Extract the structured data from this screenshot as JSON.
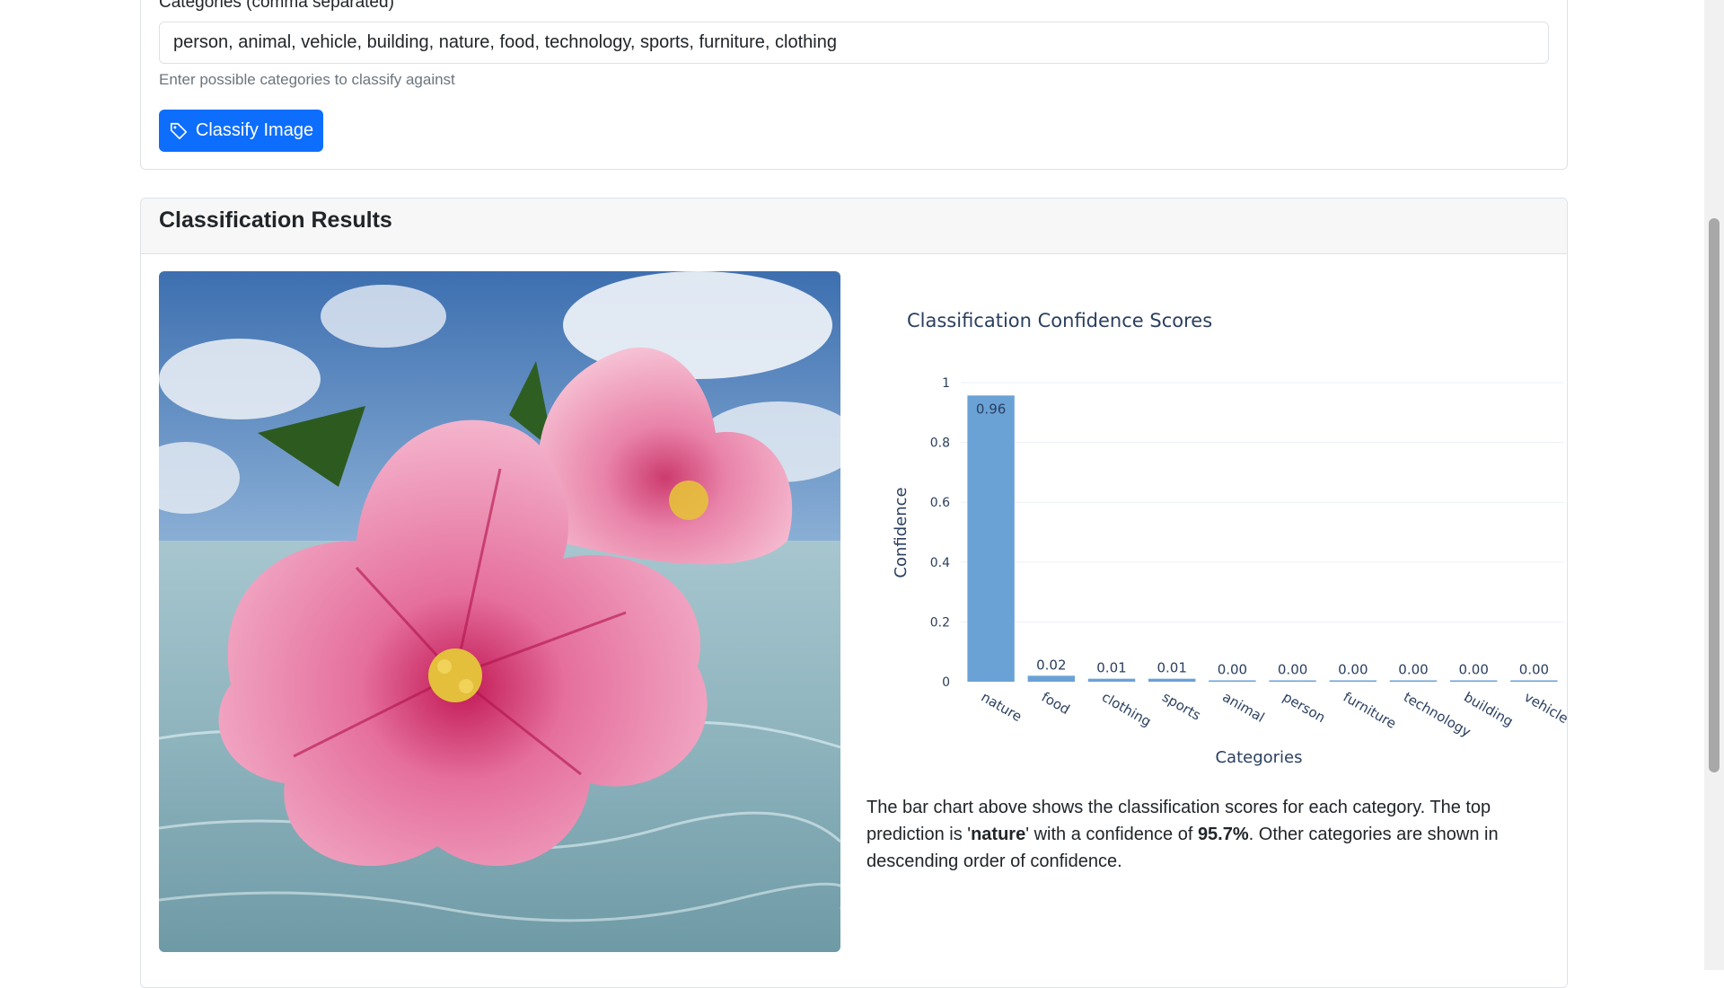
{
  "form": {
    "categories_label": "Categories (comma separated)",
    "categories_value": "person, animal, vehicle, building, nature, food, technology, sports, furniture, clothing",
    "help_text": "Enter possible categories to classify against",
    "classify_button": "Classify Image",
    "classify_icon": "tag-icon"
  },
  "results": {
    "title": "Classification Results",
    "description": {
      "pre": "The bar chart above shows the classification scores for each category. The top prediction is '",
      "top_category": "nature",
      "mid": "' with a confidence of ",
      "confidence": "95.7%",
      "post": ". Other categories are shown in descending order of confidence."
    }
  },
  "chart_data": {
    "type": "bar",
    "title": "Classification Confidence Scores",
    "xlabel": "Categories",
    "ylabel": "Confidence",
    "categories": [
      "nature",
      "food",
      "clothing",
      "sports",
      "animal",
      "person",
      "furniture",
      "technology",
      "building",
      "vehicle"
    ],
    "values": [
      0.957,
      0.02,
      0.01,
      0.01,
      0.002,
      0.001,
      0.001,
      0.0,
      0.0,
      0.0
    ],
    "labels": [
      "0.96",
      "0.02",
      "0.01",
      "0.01",
      "0.00",
      "0.00",
      "0.00",
      "0.00",
      "0.00",
      "0.00"
    ],
    "yticks": [
      "0",
      "0.2",
      "0.4",
      "0.6",
      "0.8",
      "1"
    ],
    "ylim": [
      0,
      1
    ],
    "grid": true,
    "bar_color": "#6aa2d6"
  },
  "colors": {
    "primary": "#0d6efd",
    "header_bg": "#f7f7f7",
    "chart_text": "#2a3f5f"
  }
}
